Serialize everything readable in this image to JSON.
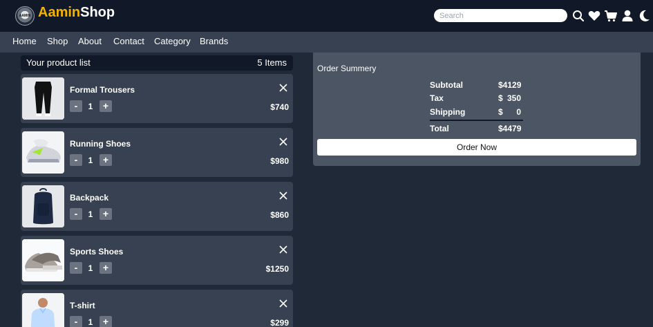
{
  "header": {
    "logo_text": "AAMIN",
    "brand_part1": "Aamin",
    "brand_part2": "Shop",
    "search_placeholder": "Search",
    "icons": [
      "search-icon",
      "heart-icon",
      "cart-icon",
      "user-icon",
      "moon-icon"
    ]
  },
  "nav": {
    "items": [
      "Home",
      "Shop",
      "About",
      "Contact",
      "Category",
      "Brands"
    ]
  },
  "list": {
    "title": "Your product list",
    "count": "5 Items",
    "items": [
      {
        "name": "Formal Trousers",
        "qty": "1",
        "price": "$740",
        "minus": "-",
        "plus": "+"
      },
      {
        "name": "Running Shoes",
        "qty": "1",
        "price": "$980",
        "minus": "-",
        "plus": "+"
      },
      {
        "name": "Backpack",
        "qty": "1",
        "price": "$860",
        "minus": "-",
        "plus": "+"
      },
      {
        "name": "Sports Shoes",
        "qty": "1",
        "price": "$1250",
        "minus": "-",
        "plus": "+"
      },
      {
        "name": "T-shirt",
        "qty": "1",
        "price": "$299",
        "minus": "-",
        "plus": "+"
      }
    ]
  },
  "summary": {
    "title": "Order Summery",
    "subtotal_label": "Subtotal",
    "subtotal_value": "$4129",
    "tax_label": "Tax",
    "tax_currency": "$",
    "tax_value": "350",
    "shipping_label": "Shipping",
    "shipping_currency": "$",
    "shipping_value": "0",
    "total_label": "Total",
    "total_value": "$4479",
    "order_button": "Order Now"
  },
  "colors": {
    "brand_accent": "#f5b301",
    "header_bg": "#111827",
    "nav_bg": "#374151",
    "page_bg": "#1f2937",
    "summary_bg": "#4b5563"
  }
}
